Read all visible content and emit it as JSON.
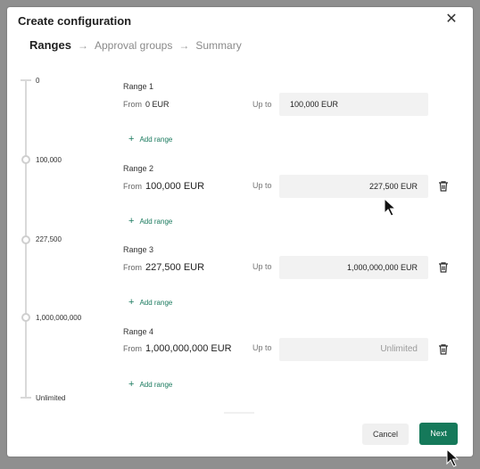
{
  "dialog": {
    "title": "Create configuration",
    "close_icon": "close-icon"
  },
  "steps": [
    {
      "label": "Ranges",
      "active": true
    },
    {
      "label": "Approval groups",
      "active": false
    },
    {
      "label": "Summary",
      "active": false
    }
  ],
  "step_arrow": "→",
  "timeline": {
    "labels": [
      "0",
      "100,000",
      "227,500",
      "1,000,000,000",
      "Unlimited"
    ]
  },
  "ranges": [
    {
      "title": "Range 1",
      "from_label": "From",
      "from_value": "0 EUR",
      "upto_label": "Up to",
      "upto_value": "100,000 EUR",
      "deletable": false
    },
    {
      "title": "Range 2",
      "from_label": "From",
      "from_value": "100,000 EUR",
      "upto_label": "Up to",
      "upto_value": "227,500 EUR",
      "deletable": true
    },
    {
      "title": "Range 3",
      "from_label": "From",
      "from_value": "227,500 EUR",
      "upto_label": "Up to",
      "upto_value": "1,000,000,000 EUR",
      "deletable": true
    },
    {
      "title": "Range 4",
      "from_label": "From",
      "from_value": "1,000,000,000 EUR",
      "upto_label": "Up to",
      "upto_placeholder": "Unlimited",
      "deletable": true
    }
  ],
  "add_range_label": "Add range",
  "buttons": {
    "cancel": "Cancel",
    "next": "Next"
  },
  "colors": {
    "accent": "#15795a",
    "link": "#1a7a5e",
    "field_bg": "#f2f2f2"
  }
}
